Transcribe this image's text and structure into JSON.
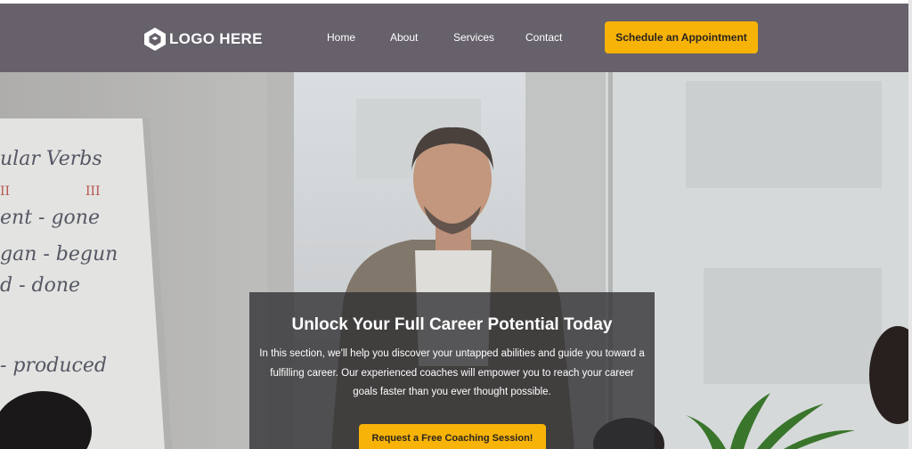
{
  "brand": {
    "logo_text": "LOGO HERE",
    "logo_icon": "hexagon-logo-icon",
    "accent_color": "#f7b307",
    "header_color": "#66616a"
  },
  "nav": {
    "items": [
      {
        "label": "Home"
      },
      {
        "label": "About"
      },
      {
        "label": "Services"
      },
      {
        "label": "Contact"
      }
    ],
    "cta_label": "Schedule an Appointment"
  },
  "hero": {
    "title": "Unlock Your Full Career Potential Today",
    "text": "In this section, we'll help you discover your untapped abilities and guide you toward a fulfilling career. Our experienced coaches will empower you to reach your career goals faster than you ever thought possible.",
    "button_label": "Request a Free Coaching Session!",
    "whiteboard_lines": [
      "ular Verbs",
      "II",
      "III",
      "ent - gone",
      "gan - begun",
      "d - done",
      "- produced"
    ]
  }
}
